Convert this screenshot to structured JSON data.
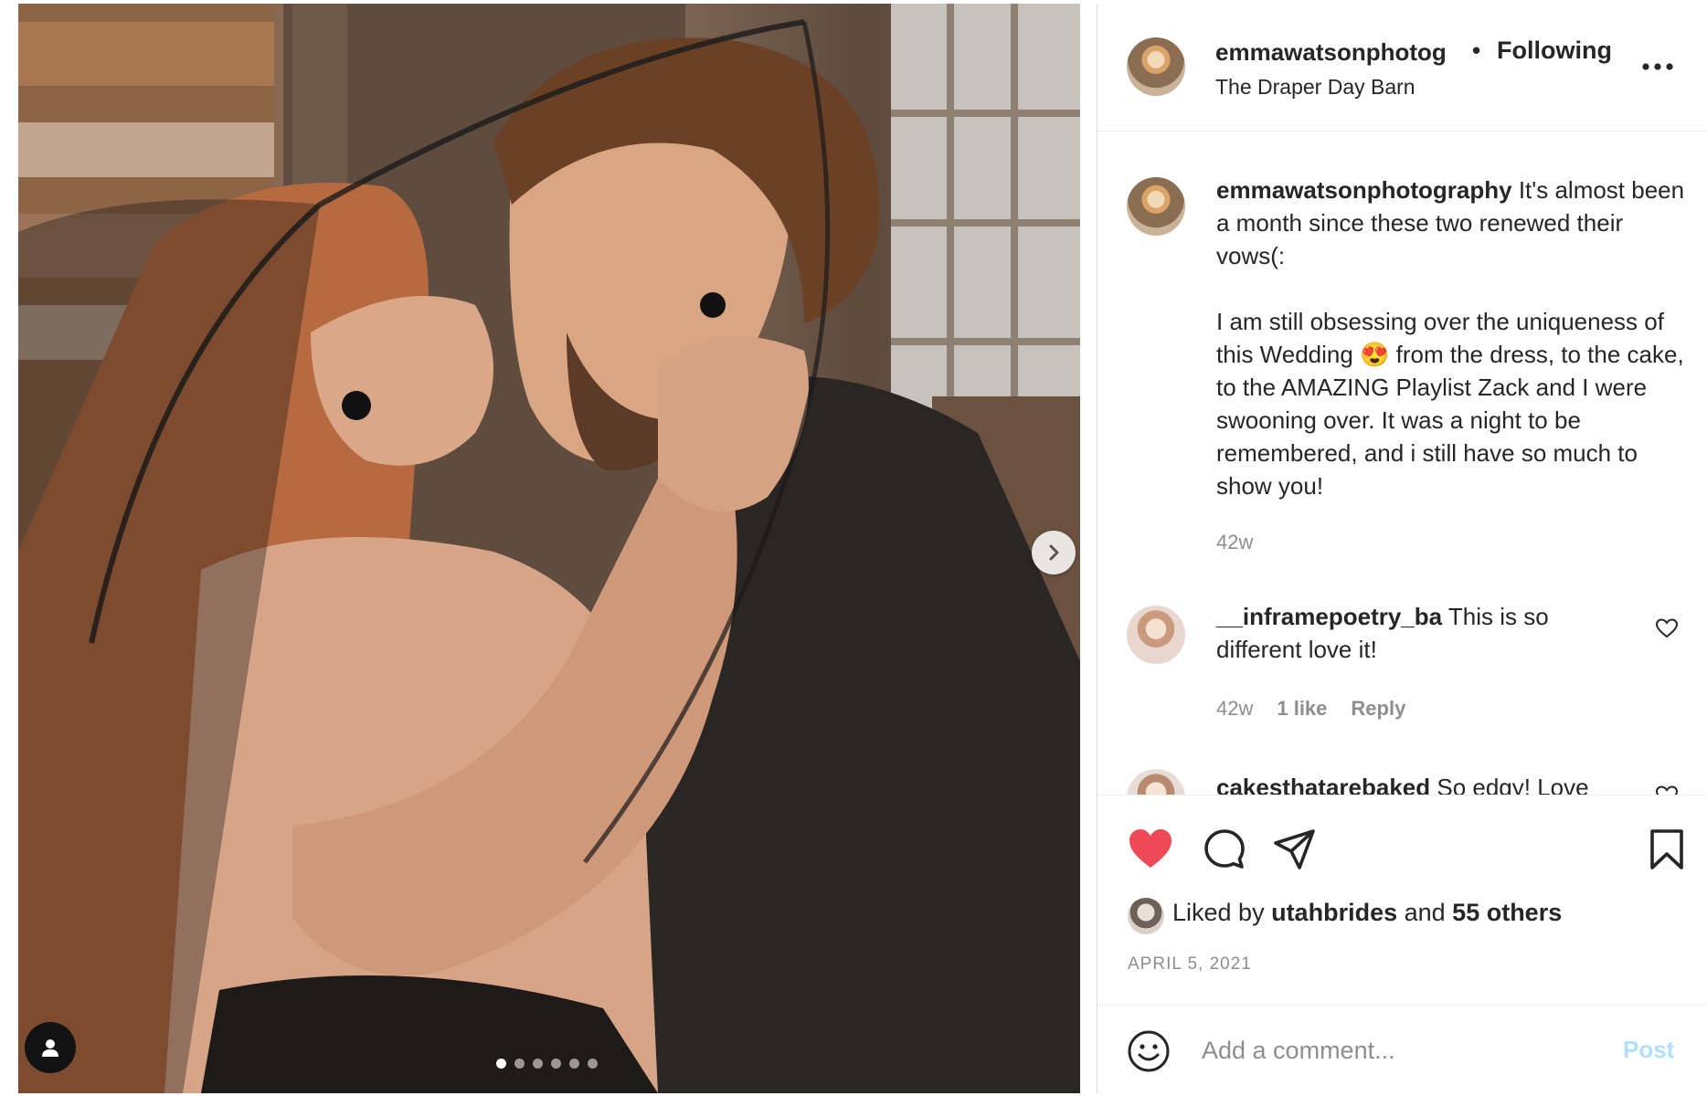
{
  "header": {
    "username": "emmawatsonphotog",
    "separator": "•",
    "follow_status": "Following",
    "location": "The Draper Day Barn"
  },
  "caption": {
    "username": "emmawatsonphotography",
    "text": " It's almost been a month since these two renewed their vows(:\n\nI am still obsessing over the uniqueness of this Wedding 😍 from the dress, to the cake, to the AMAZING Playlist Zack and I were swooning over. It was a night to be remembered, and i still have so much to show you!",
    "time": "42w"
  },
  "comments": [
    {
      "username": "__inframepoetry_ba",
      "text": " This is so different love it!",
      "time": "42w",
      "likes": "1 like",
      "reply": "Reply"
    },
    {
      "username": "cakesthatarebaked",
      "text": " So edgy! Love"
    }
  ],
  "likes": {
    "prefix": "Liked by ",
    "user": "utahbrides",
    "middle": " and ",
    "others": "55 others"
  },
  "post_date": "APRIL 5, 2021",
  "comment_box": {
    "placeholder": "Add a comment...",
    "post_label": "Post"
  },
  "carousel": {
    "count": 6,
    "active_index": 0
  },
  "colors": {
    "like_red": "#ED4956",
    "post_button_disabled": "#B2DFFC",
    "secondary_text": "#8E8E8E"
  },
  "icons": [
    "heart-filled-icon",
    "comment-icon",
    "share-icon",
    "bookmark-icon",
    "more-icon",
    "emoji-icon",
    "user-tag-icon",
    "chevron-right-icon",
    "small-heart-icon"
  ]
}
